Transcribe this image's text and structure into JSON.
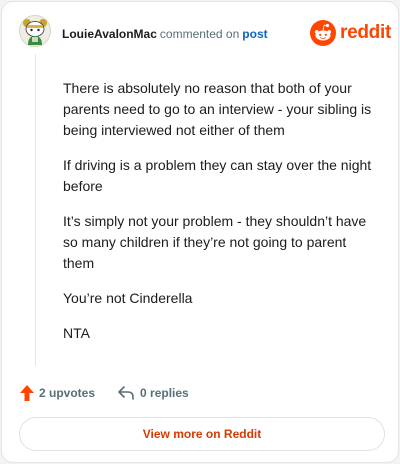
{
  "header": {
    "username": "LouieAvalonMac",
    "action": "commented on",
    "post_link": "post",
    "brand": "reddit"
  },
  "comment": {
    "paragraphs": [
      "There is absolutely no reason that both of your parents need to go to an interview - your sibling is being interviewed not either of them",
      "If driving is a problem they can stay over the night before",
      "It’s simply not your problem - they shouldn’t have so many children if they’re not going to parent them",
      "You’re not Cinderella",
      "NTA"
    ]
  },
  "footer": {
    "upvotes": "2 upvotes",
    "replies": "0 replies"
  },
  "view_more_label": "View more on Reddit",
  "colors": {
    "brand": "#ff4500",
    "link": "#0a66c2",
    "muted": "#576f76",
    "cta": "#d93900"
  },
  "icons": {
    "avatar": "snoo-avatar",
    "brand": "reddit-snoo-icon",
    "upvote": "upvote-arrow-icon",
    "reply": "reply-arrow-icon"
  }
}
